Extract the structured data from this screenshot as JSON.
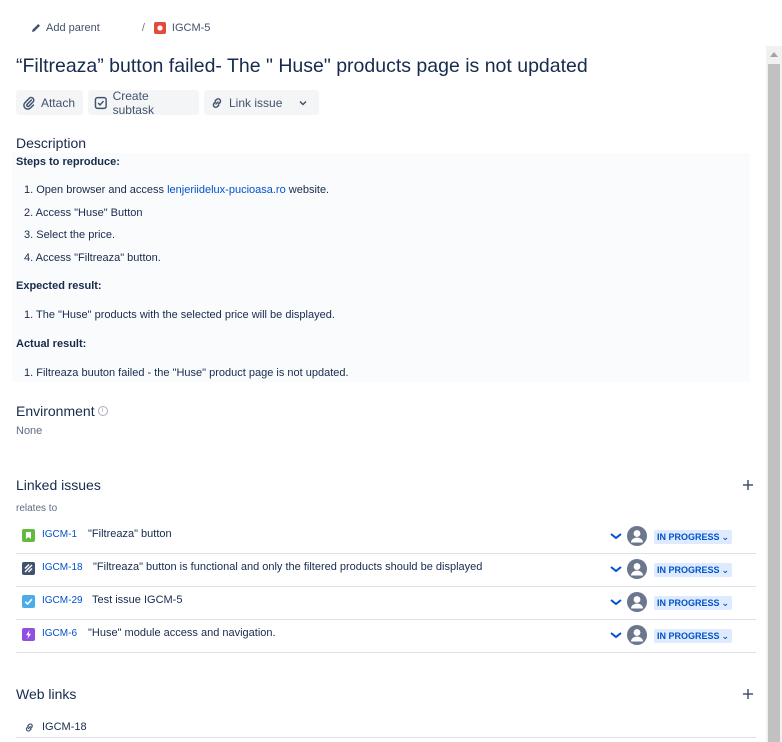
{
  "breadcrumb": {
    "add_parent": "Add parent",
    "separator": "/",
    "issue_key": "IGCM-5"
  },
  "title": "“Filtreaza” button failed- The \" Huse\" products page is not updated",
  "toolbar": {
    "attach": "Attach",
    "create_subtask": "Create subtask",
    "link_issue": "Link issue"
  },
  "description": {
    "heading": "Description",
    "steps_label": "Steps to reproduce:",
    "step1_prefix": "1. Open browser and access ",
    "step1_link": "lenjeriidelux-pucioasa.ro",
    "step1_suffix": " website.",
    "step2": "2.  Access \"Huse\" Button",
    "step3": "3. Select the  price.",
    "step4": "4. Access \"Filtreaza\" button.",
    "expected_label": "Expected result:",
    "expected1": "1. The  \"Huse\" products with the selected price will be displayed.",
    "actual_label": "Actual result:",
    "actual1": "1. Filtreaza buuton failed - the \"Huse\" product page is not updated."
  },
  "environment": {
    "heading": "Environment",
    "value": "None"
  },
  "linked_issues": {
    "heading": "Linked issues",
    "relation": "relates to",
    "items": [
      {
        "key": "IGCM-1",
        "summary": "\"Filtreaza\" button",
        "status": "IN PROGRESS",
        "type": "story",
        "color": "#63ba3c"
      },
      {
        "key": "IGCM-18",
        "summary": "\"Filtreaza\" button is functional and only the filtered products should be displayed",
        "status": "IN PROGRESS",
        "type": "test",
        "color": "#42526e"
      },
      {
        "key": "IGCM-29",
        "summary": "Test issue IGCM-5",
        "status": "IN PROGRESS",
        "type": "task",
        "color": "#4bade8"
      },
      {
        "key": "IGCM-6",
        "summary": "\"Huse\" module access and navigation.",
        "status": "IN PROGRESS",
        "type": "epic",
        "color": "#904ee2"
      }
    ]
  },
  "web_links": {
    "heading": "Web links",
    "items": [
      {
        "label": "IGCM-18"
      }
    ]
  },
  "colors": {
    "link": "#0052cc",
    "status_bg": "#deebff",
    "bug": "#e5493a"
  },
  "icons": [
    "pencil-icon",
    "bug-icon",
    "paperclip-icon",
    "subtask-icon",
    "link-icon",
    "chevron-down-icon",
    "plus-icon",
    "avatar-icon"
  ]
}
